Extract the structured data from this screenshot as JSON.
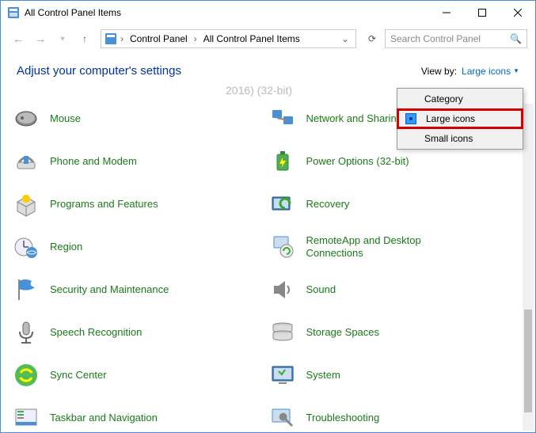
{
  "title": "All Control Panel Items",
  "nav": {
    "crumb1": "Control Panel",
    "crumb2": "All Control Panel Items"
  },
  "search": {
    "placeholder": "Search Control Panel"
  },
  "header": {
    "heading": "Adjust your computer's settings",
    "viewby_label": "View by:",
    "viewby_value": "Large icons"
  },
  "truncated_top": "2016) (32-bit)",
  "dropdown": {
    "opt0": "Category",
    "opt1": "Large icons",
    "opt2": "Small icons"
  },
  "items": {
    "mouse": "Mouse",
    "network": "Network and Sharing Center",
    "phone": "Phone and Modem",
    "power": "Power Options (32-bit)",
    "programs": "Programs and Features",
    "recovery": "Recovery",
    "region": "Region",
    "remoteapp": "RemoteApp and Desktop Connections",
    "security": "Security and Maintenance",
    "sound": "Sound",
    "speech": "Speech Recognition",
    "storage": "Storage Spaces",
    "sync": "Sync Center",
    "system": "System",
    "taskbar": "Taskbar and Navigation",
    "trouble": "Troubleshooting"
  }
}
